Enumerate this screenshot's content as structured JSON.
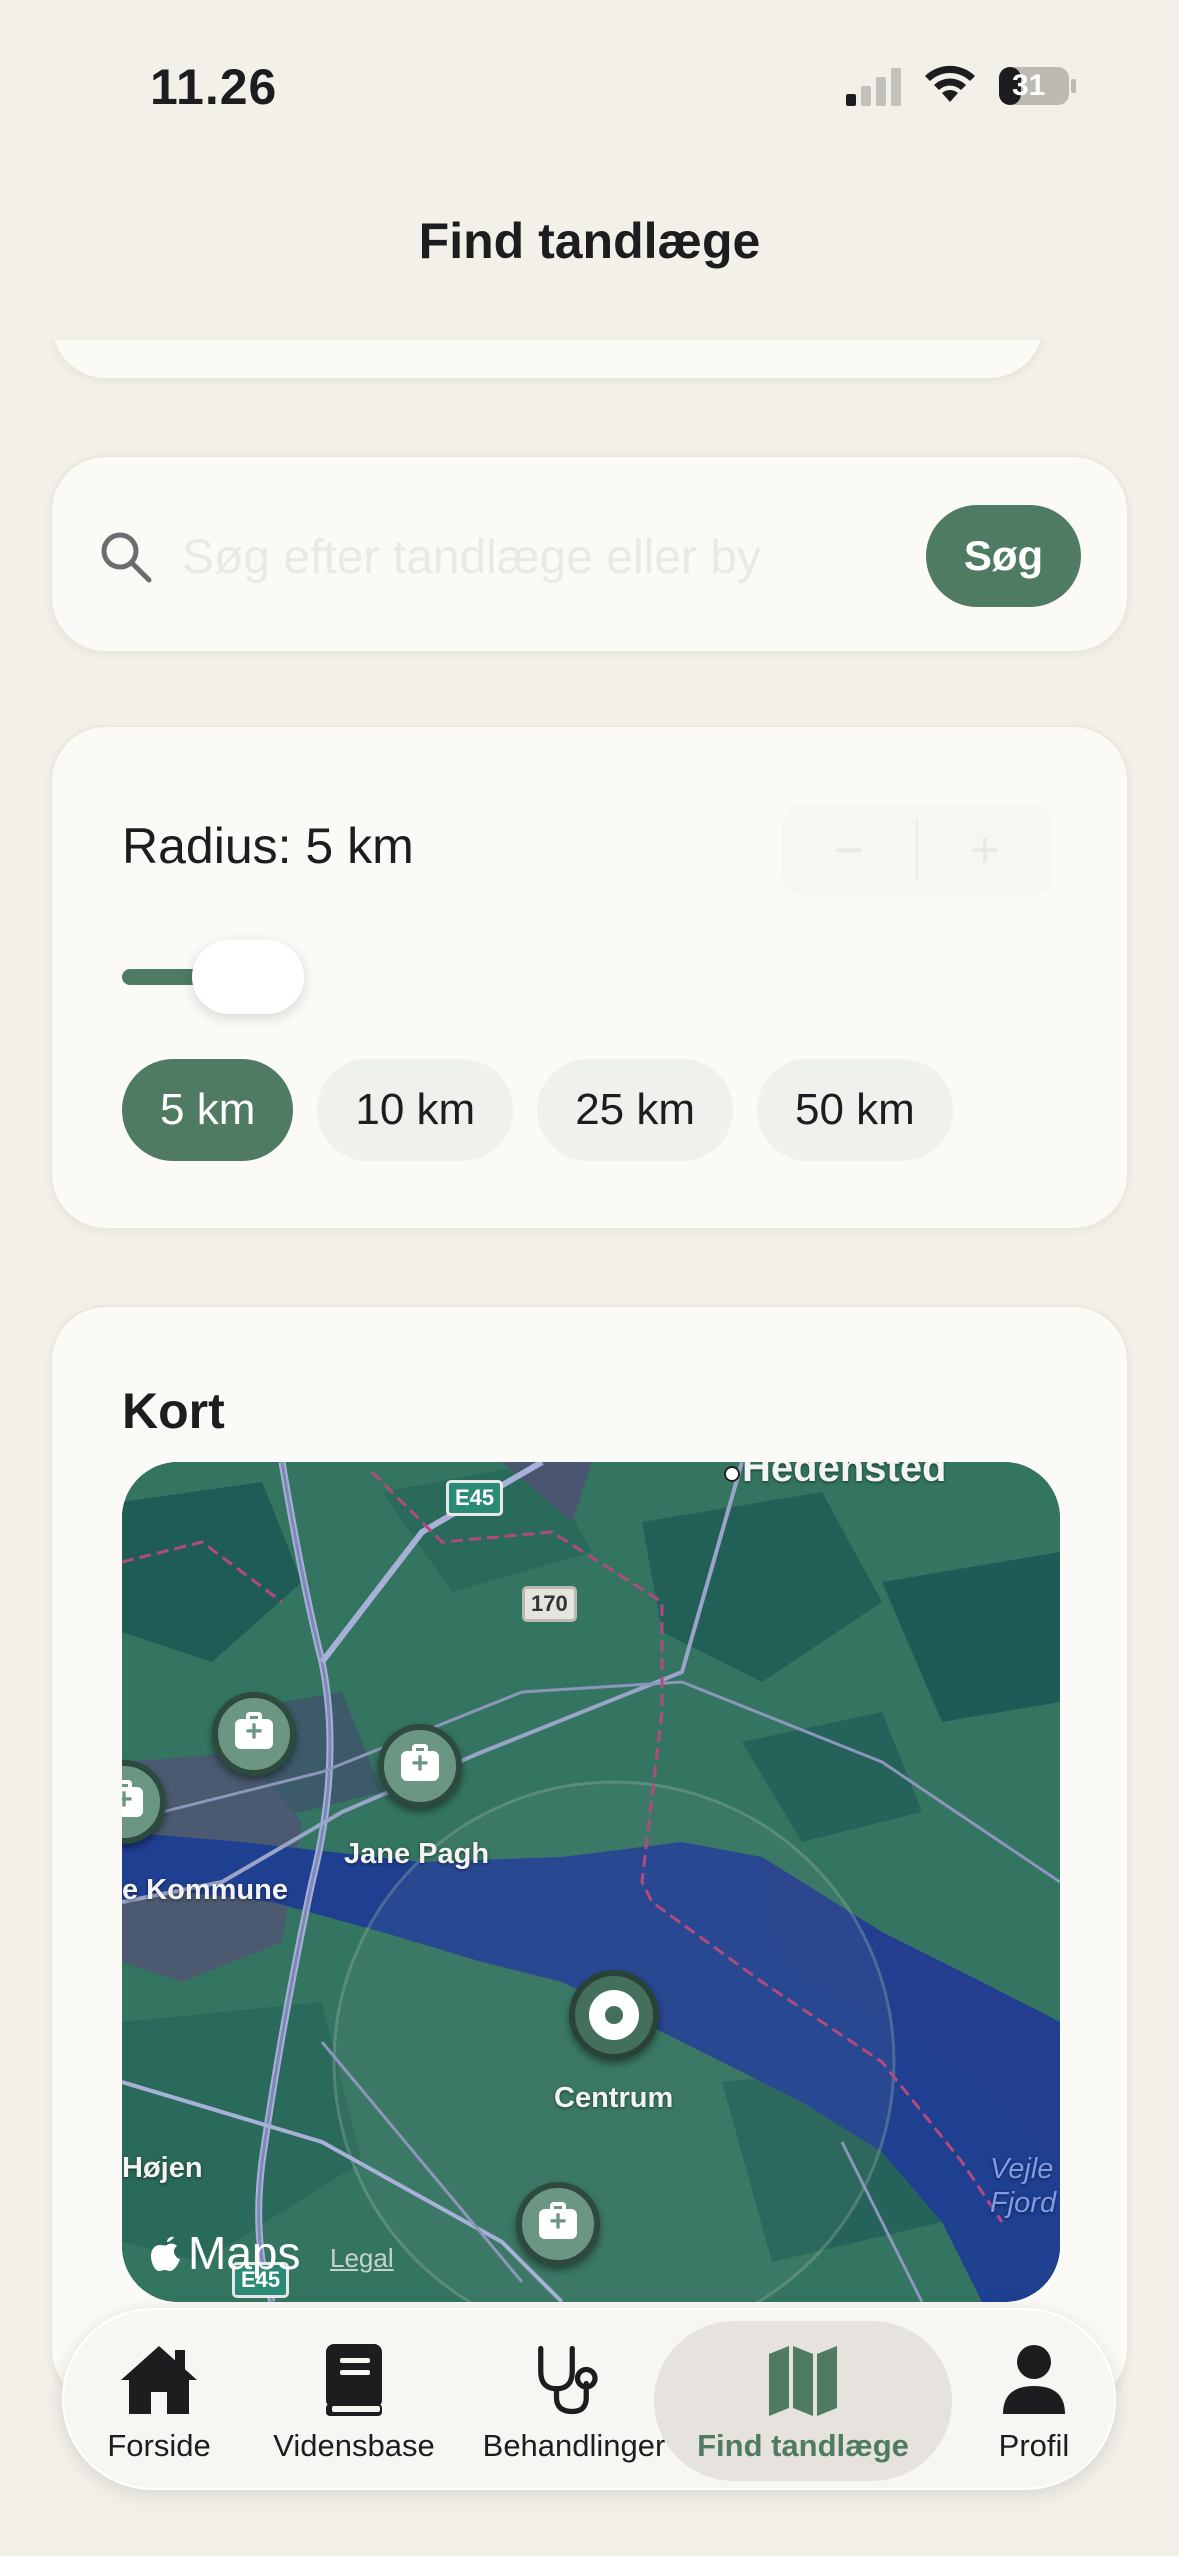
{
  "status_bar": {
    "time": "11.26",
    "battery": "31"
  },
  "header": {
    "title": "Find tandlæge"
  },
  "search": {
    "placeholder": "Søg efter tandlæge eller by",
    "button_label": "Søg"
  },
  "radius": {
    "label": "Radius: 5 km",
    "minus": "−",
    "plus": "+",
    "slider_value_fraction": 0.0,
    "chips": [
      {
        "label": "5 km",
        "selected": true
      },
      {
        "label": "10 km",
        "selected": false
      },
      {
        "label": "25 km",
        "selected": false
      },
      {
        "label": "50 km",
        "selected": false
      }
    ]
  },
  "map": {
    "title": "Kort",
    "labels": {
      "hedensted": "Hedensted",
      "jane_pagh": "Jane Pagh",
      "kommune": "e Kommune",
      "centrum": "Centrum",
      "hojen": "Højen",
      "vejle_fjord": "Vejle Fjord"
    },
    "roads": {
      "e45_top": "E45",
      "r170": "170",
      "e45_bottom": "E45"
    },
    "attribution": {
      "maps": "Maps",
      "legal": "Legal"
    }
  },
  "tabs": [
    {
      "label": "Forside",
      "icon": "house-icon",
      "active": false
    },
    {
      "label": "Vidensbase",
      "icon": "book-icon",
      "active": false
    },
    {
      "label": "Behandlinger",
      "icon": "stethoscope-icon",
      "active": false
    },
    {
      "label": "Find tandlæge",
      "icon": "map-icon",
      "active": true
    },
    {
      "label": "Profil",
      "icon": "person-icon",
      "active": false
    }
  ],
  "colors": {
    "accent": "#4f7b62",
    "background": "#f3f0ea",
    "card": "#fbfaf6"
  }
}
